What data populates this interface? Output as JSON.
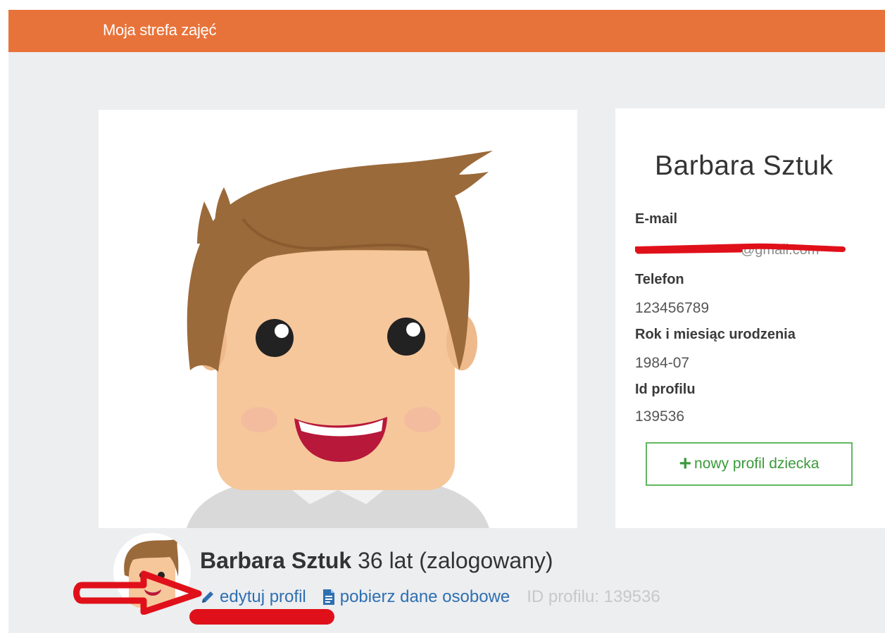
{
  "topbar": {
    "title": "Moja strefa zajęć",
    "color": "#e8733a"
  },
  "profile_card": {
    "name": "Barbara Sztuk",
    "email_label": "E-mail",
    "email_visible_suffix": "@gmail.com",
    "phone_label": "Telefon",
    "phone_value": "123456789",
    "birth_label": "Rok i miesiąc urodzenia",
    "birth_value": "1984-07",
    "profile_id_label": "Id profilu",
    "profile_id_value": "139536",
    "new_child_button": "nowy profil dziecka",
    "new_child_icon": "plus-icon"
  },
  "profile_summary": {
    "name": "Barbara Sztuk",
    "age_text": "36 lat (zalogowany)",
    "edit_link": "edytuj profil",
    "edit_icon": "pencil-icon",
    "download_link": "pobierz dane osobowe",
    "download_icon": "document-icon",
    "id_text": "ID profilu: 139536"
  },
  "colors": {
    "accent_orange": "#e8733a",
    "link_blue": "#2f6fb0",
    "button_green": "#3a9a3a",
    "annotation_red": "#e0101a"
  }
}
